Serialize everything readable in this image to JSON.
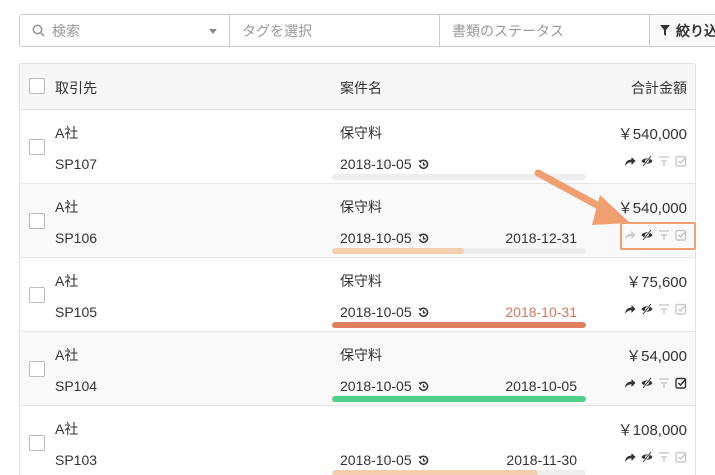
{
  "filters": {
    "search_placeholder": "検索",
    "tag_placeholder": "タグを選択",
    "status_placeholder": "書類のステータス",
    "filter_button": "絞り込"
  },
  "table": {
    "headers": {
      "client": "取引先",
      "case": "案件名",
      "total": "合計金額"
    },
    "rows": [
      {
        "client": "A社",
        "code": "SP107",
        "case": "保守料",
        "start": "2018-10-05",
        "due": "",
        "amount": "￥540,000",
        "progress": 0.0,
        "bar_color": "#eeeeee",
        "due_color": "#333333",
        "approved": false
      },
      {
        "client": "A社",
        "code": "SP106",
        "case": "保守料",
        "start": "2018-10-05",
        "due": "2018-12-31",
        "amount": "￥540,000",
        "progress": 0.52,
        "bar_color": "#f3cfae",
        "due_color": "#333333",
        "approved": false
      },
      {
        "client": "A社",
        "code": "SP105",
        "case": "保守料",
        "start": "2018-10-05",
        "due": "2018-10-31",
        "amount": "￥75,600",
        "progress": 1.0,
        "bar_color": "#e07f60",
        "due_color": "#d9775c",
        "approved": false
      },
      {
        "client": "A社",
        "code": "SP104",
        "case": "保守料",
        "start": "2018-10-05",
        "due": "2018-10-05",
        "amount": "￥54,000",
        "progress": 1.0,
        "bar_color": "#4fce8a",
        "due_color": "#333333",
        "approved": true
      },
      {
        "client": "A社",
        "code": "SP103",
        "case": "",
        "start": "2018-10-05",
        "due": "2018-11-30",
        "amount": "￥108,000",
        "progress": 0.81,
        "bar_color": "#f3cfae",
        "due_color": "#333333",
        "approved": false
      }
    ]
  },
  "colors": {
    "highlight": "#f0a070",
    "overdue": "#d9775c",
    "done": "#4fce8a"
  }
}
